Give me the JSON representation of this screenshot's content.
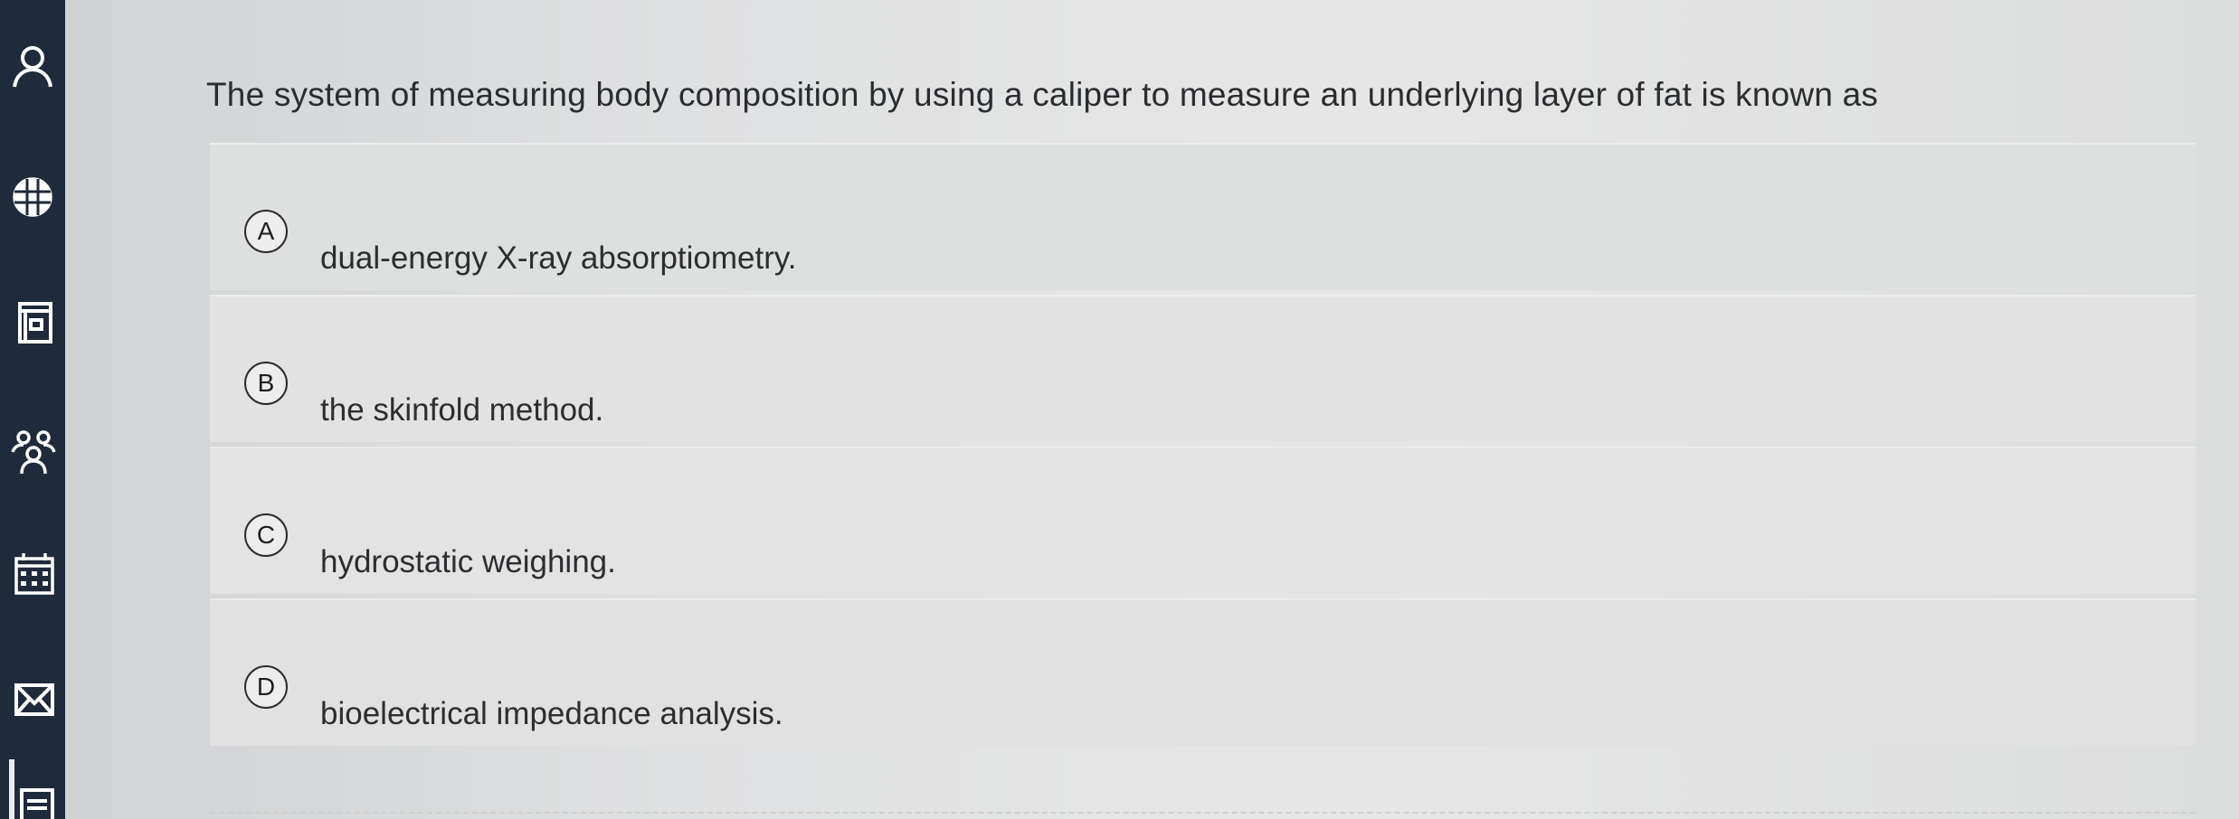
{
  "sidebar": {
    "items": [
      {
        "icon": "user-icon"
      },
      {
        "icon": "globe-icon"
      },
      {
        "icon": "notebook-icon"
      },
      {
        "icon": "group-icon"
      },
      {
        "icon": "calendar-icon"
      },
      {
        "icon": "mail-icon"
      },
      {
        "icon": "list-icon"
      }
    ]
  },
  "question": {
    "text": "The system of measuring body composition by using a caliper to measure an underlying layer of fat is known as"
  },
  "options": [
    {
      "letter": "A",
      "text": "dual-energy X-ray absorptiometry."
    },
    {
      "letter": "B",
      "text": "the skinfold method."
    },
    {
      "letter": "C",
      "text": "hydrostatic weighing."
    },
    {
      "letter": "D",
      "text": "bioelectrical impedance analysis."
    }
  ]
}
